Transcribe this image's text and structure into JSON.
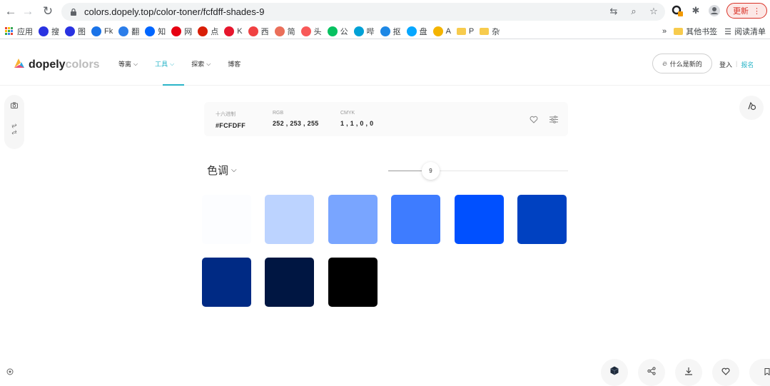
{
  "browser": {
    "url": "colors.dopely.top/color-toner/fcfdff-shades-9",
    "update_label": "更新",
    "bookmarks": [
      {
        "label": "应用",
        "icon": "apps-icon",
        "color": "#4285f4"
      },
      {
        "label": "搜",
        "icon": "baidu-icon",
        "color": "#2932e1"
      },
      {
        "label": "图",
        "icon": "baidu-image-icon",
        "color": "#2932e1"
      },
      {
        "label": "Fk",
        "icon": "robot-icon",
        "color": "#1a73e8"
      },
      {
        "label": "翻",
        "icon": "translate-icon",
        "color": "#2b7de9"
      },
      {
        "label": "知",
        "icon": "zhihu-icon",
        "color": "#0066ff"
      },
      {
        "label": "网",
        "icon": "netease-icon",
        "color": "#e60012"
      },
      {
        "label": "点",
        "icon": "dianping-icon",
        "color": "#d81e06"
      },
      {
        "label": "K",
        "icon": "weibo-icon",
        "color": "#e6162d"
      },
      {
        "label": "西",
        "icon": "xigua-icon",
        "color": "#f04142"
      },
      {
        "label": "简",
        "icon": "jianshu-icon",
        "color": "#ea6f5a"
      },
      {
        "label": "头",
        "icon": "toutiao-icon",
        "color": "#f85959"
      },
      {
        "label": "公",
        "icon": "wechat-icon",
        "color": "#07c160"
      },
      {
        "label": "哔",
        "icon": "bilibili-icon",
        "color": "#00a1d6"
      },
      {
        "label": "抠",
        "icon": "bird-icon",
        "color": "#1e88e5"
      },
      {
        "label": "盘",
        "icon": "baidupan-icon",
        "color": "#06a7ff"
      },
      {
        "label": "A",
        "icon": "a-icon",
        "color": "#f4b400"
      },
      {
        "label": "P",
        "icon": "folder-icon",
        "color": "#f7cb4d"
      },
      {
        "label": "杂",
        "icon": "folder-icon",
        "color": "#f7cb4d"
      }
    ],
    "bookmarks_more": "»",
    "other_bookmarks": "其他书签",
    "reading_list": "阅读清单"
  },
  "site": {
    "logo_part1": "dopely",
    "logo_part2": "colors",
    "nav": [
      {
        "label": "等离",
        "active": false
      },
      {
        "label": "工具",
        "active": true
      },
      {
        "label": "探索",
        "active": false
      },
      {
        "label": "博客",
        "active": false
      }
    ],
    "whats_new": "什么是新的",
    "login": "登入",
    "separator": "|",
    "signup": "报名"
  },
  "color_info": {
    "hex_label": "十六进制",
    "hex_value": "#FCFDFF",
    "rgb_label": "RGB",
    "rgb_value": "252 , 253 , 255",
    "cmyk_label": "CMYK",
    "cmyk_value": "1 , 1 , 0 , 0"
  },
  "shades": {
    "title": "色调",
    "count": "9",
    "slider_fraction": 0.22,
    "swatches": [
      "#fcfdff",
      "#bcd3ff",
      "#79a5ff",
      "#3e7cff",
      "#0050ff",
      "#0041c1",
      "#002a84",
      "#001642",
      "#000000"
    ]
  },
  "actions": {
    "save_label": "节省"
  }
}
